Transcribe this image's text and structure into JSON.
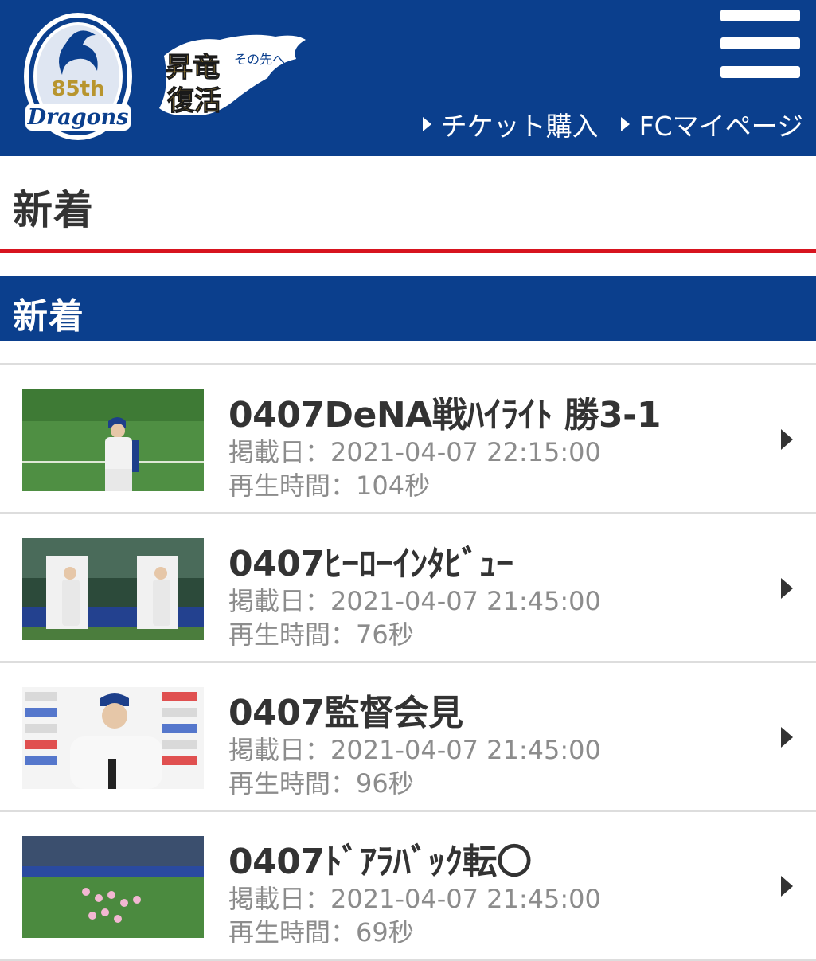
{
  "header": {
    "logo_text": "85th Dragons",
    "slogan_text": "昇竜復活 その先へ",
    "links": [
      {
        "label": "チケット購入"
      },
      {
        "label": "FCマイページ"
      }
    ]
  },
  "page_title": "新着",
  "section_title": "新着",
  "videos": [
    {
      "title": "0407DeNA戦ﾊｲﾗｲﾄ 勝3-1",
      "date": "掲載日：2021-04-07 22:15:00",
      "duration": "再生時間：104秒"
    },
    {
      "title": "0407ﾋｰﾛｰｲﾝﾀﾋﾞｭｰ",
      "date": "掲載日：2021-04-07 21:45:00",
      "duration": "再生時間：76秒"
    },
    {
      "title": "0407監督会見",
      "date": "掲載日：2021-04-07 21:45:00",
      "duration": "再生時間：96秒"
    },
    {
      "title": "0407ﾄﾞｱﾗﾊﾞｯｸ転〇",
      "date": "掲載日：2021-04-07 21:45:00",
      "duration": "再生時間：69秒"
    }
  ]
}
